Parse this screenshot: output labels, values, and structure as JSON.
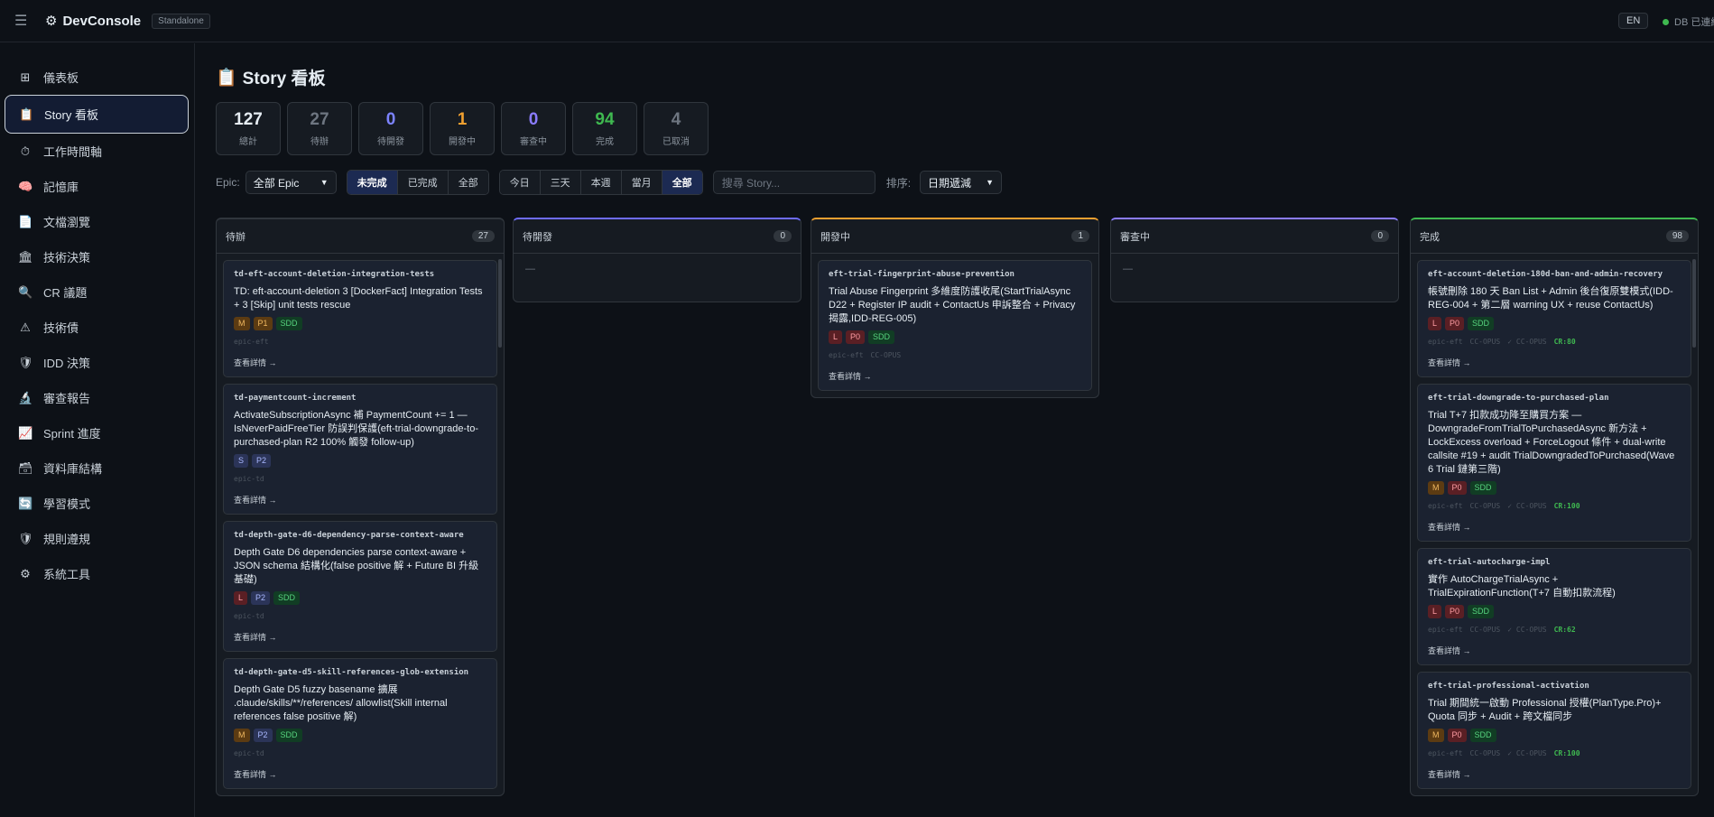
{
  "app": {
    "title": "DevConsole",
    "badge": "Standalone",
    "lang": "EN",
    "db_status": "DB 已連線"
  },
  "sidebar": {
    "items": [
      {
        "icon": "⊞",
        "label": "儀表板"
      },
      {
        "icon": "📋",
        "label": "Story 看板"
      },
      {
        "icon": "⏱",
        "label": "工作時間軸"
      },
      {
        "icon": "🧠",
        "label": "記憶庫"
      },
      {
        "icon": "📄",
        "label": "文檔瀏覽"
      },
      {
        "icon": "🏛",
        "label": "技術決策"
      },
      {
        "icon": "🔍",
        "label": "CR 議題"
      },
      {
        "icon": "⚠",
        "label": "技術債"
      },
      {
        "icon": "🛡",
        "label": "IDD 決策"
      },
      {
        "icon": "🔬",
        "label": "審查報告"
      },
      {
        "icon": "📈",
        "label": "Sprint 進度"
      },
      {
        "icon": "🗃",
        "label": "資料庫結構"
      },
      {
        "icon": "🔄",
        "label": "學習模式"
      },
      {
        "icon": "🛡",
        "label": "規則遵規"
      },
      {
        "icon": "⚙",
        "label": "系統工具"
      }
    ]
  },
  "page": {
    "icon": "📋",
    "title": "Story 看板"
  },
  "stats": [
    {
      "value": "127",
      "label": "總計",
      "color": "#e6edf3"
    },
    {
      "value": "27",
      "label": "待辦",
      "color": "#6e7681"
    },
    {
      "value": "0",
      "label": "待開發",
      "color": "#7c83ff"
    },
    {
      "value": "1",
      "label": "開發中",
      "color": "#f0a030"
    },
    {
      "value": "0",
      "label": "審查中",
      "color": "#8b7cff"
    },
    {
      "value": "94",
      "label": "完成",
      "color": "#3fb950"
    },
    {
      "value": "4",
      "label": "已取消",
      "color": "#6e7681"
    }
  ],
  "filters": {
    "epic_label": "Epic:",
    "epic_value": "全部 Epic",
    "status_tabs": [
      "未完成",
      "已完成",
      "全部"
    ],
    "time_tabs": [
      "今日",
      "三天",
      "本週",
      "當月",
      "全部"
    ],
    "search_placeholder": "搜尋 Story...",
    "sort_label": "排序:",
    "sort_value": "日期遞減"
  },
  "columns": [
    {
      "title": "待辦",
      "count": "27",
      "accent": "#30363d",
      "cards": [
        {
          "id": "td-eft-account-deletion-integration-tests",
          "title": "TD: eft-account-deletion 3 [DockerFact] Integration Tests + 3 [Skip] unit tests rescue",
          "tags": [
            "M",
            "P1",
            "SDD"
          ],
          "meta": [
            "epic-eft"
          ],
          "cr": "",
          "detail": "查看詳情 →"
        },
        {
          "id": "td-paymentcount-increment",
          "title": "ActivateSubscriptionAsync 補 PaymentCount += 1 — IsNeverPaidFreeTier 防誤判保護(eft-trial-downgrade-to-purchased-plan R2 100% 觸發 follow-up)",
          "tags": [
            "S",
            "P2"
          ],
          "meta": [
            "epic-td"
          ],
          "cr": "",
          "detail": "查看詳情 →"
        },
        {
          "id": "td-depth-gate-d6-dependency-parse-context-aware",
          "title": "Depth Gate D6 dependencies parse context-aware + JSON schema 結構化(false positive 解 + Future BI 升級基礎)",
          "tags": [
            "L",
            "P2",
            "SDD"
          ],
          "meta": [
            "epic-td"
          ],
          "cr": "",
          "detail": "查看詳情 →"
        },
        {
          "id": "td-depth-gate-d5-skill-references-glob-extension",
          "title": "Depth Gate D5 fuzzy basename 擴展 .claude/skills/**/references/ allowlist(Skill internal references false positive 解)",
          "tags": [
            "M",
            "P2",
            "SDD"
          ],
          "meta": [
            "epic-td"
          ],
          "cr": "",
          "detail": "查看詳情 →"
        }
      ]
    },
    {
      "title": "待開發",
      "count": "0",
      "accent": "#6e6cff",
      "empty": "—",
      "cards": []
    },
    {
      "title": "開發中",
      "count": "1",
      "accent": "#f0a030",
      "cards": [
        {
          "id": "eft-trial-fingerprint-abuse-prevention",
          "title": "Trial Abuse Fingerprint 多維度防護收尾(StartTrialAsync D22 + Register IP audit + ContactUs 申訴整合 + Privacy 揭露,IDD-REG-005)",
          "tags": [
            "L",
            "P0",
            "SDD"
          ],
          "meta": [
            "epic-eft",
            "CC-OPUS"
          ],
          "cr": "",
          "detail": "查看詳情 →"
        }
      ]
    },
    {
      "title": "審查中",
      "count": "0",
      "accent": "#8b7cff",
      "empty": "—",
      "cards": []
    },
    {
      "title": "完成",
      "count": "98",
      "accent": "#3fb950",
      "cards": [
        {
          "id": "eft-account-deletion-180d-ban-and-admin-recovery",
          "title": "帳號刪除 180 天 Ban List + Admin 後台復原雙模式(IDD-REG-004 + 第二層 warning UX + reuse ContactUs)",
          "tags": [
            "L",
            "P0",
            "SDD"
          ],
          "meta": [
            "epic-eft",
            "CC-OPUS",
            "✓ CC-OPUS"
          ],
          "cr": "CR:80",
          "detail": "查看詳情 →"
        },
        {
          "id": "eft-trial-downgrade-to-purchased-plan",
          "title": "Trial T+7 扣款成功降至購買方案 — DowngradeFromTrialToPurchasedAsync 新方法 + LockExcess overload + ForceLogout 條件 + dual-write callsite #19 + audit TrialDowngradedToPurchased(Wave 6 Trial 鏈第三階)",
          "tags": [
            "M",
            "P0",
            "SDD"
          ],
          "meta": [
            "epic-eft",
            "CC-OPUS",
            "✓ CC-OPUS"
          ],
          "cr": "CR:100",
          "detail": "查看詳情 →"
        },
        {
          "id": "eft-trial-autocharge-impl",
          "title": "實作 AutoChargeTrialAsync + TrialExpirationFunction(T+7 自動扣款流程)",
          "tags": [
            "L",
            "P0",
            "SDD"
          ],
          "meta": [
            "epic-eft",
            "CC-OPUS",
            "✓ CC-OPUS"
          ],
          "cr": "CR:62",
          "detail": "查看詳情 →"
        },
        {
          "id": "eft-trial-professional-activation",
          "title": "Trial 期間統一啟動 Professional 授權(PlanType.Pro)+ Quota 同步 + Audit + 跨文檔同步",
          "tags": [
            "M",
            "P0",
            "SDD"
          ],
          "meta": [
            "epic-eft",
            "CC-OPUS",
            "✓ CC-OPUS"
          ],
          "cr": "CR:100",
          "detail": "查看詳情 →"
        }
      ]
    }
  ]
}
